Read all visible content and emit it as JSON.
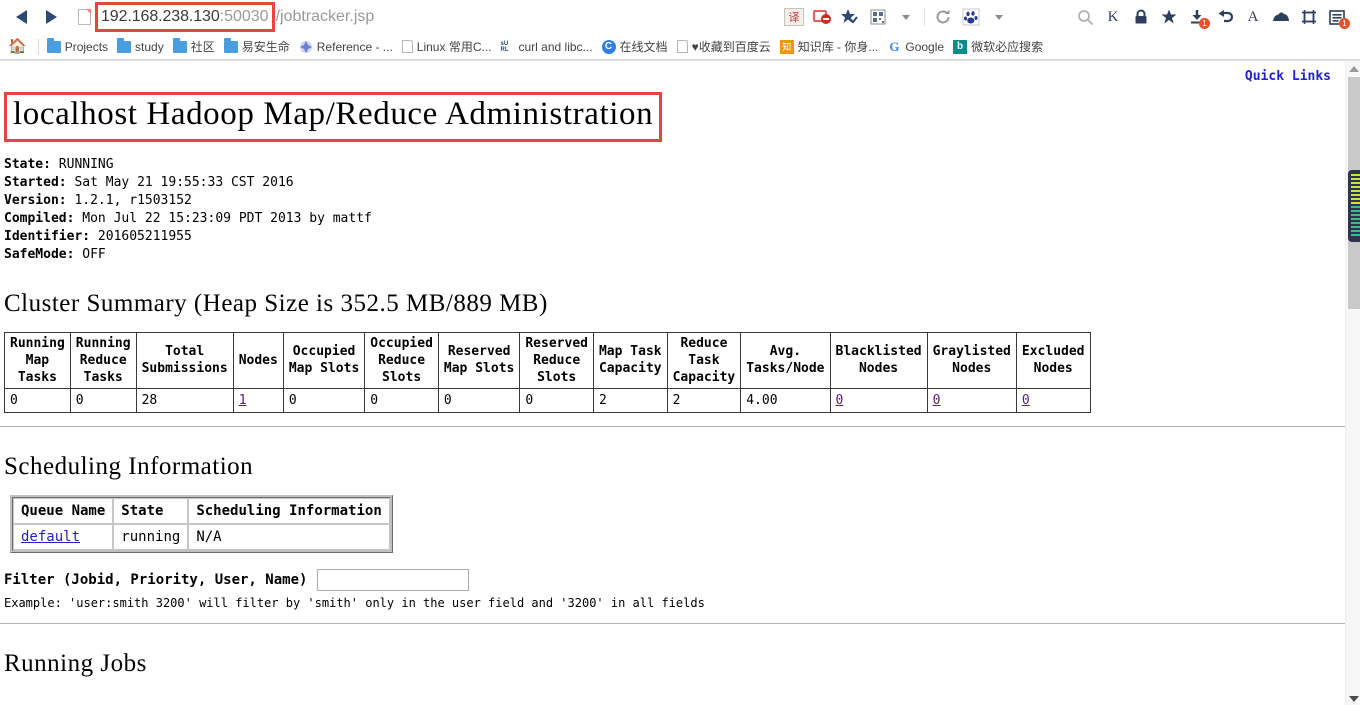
{
  "browser": {
    "nav": {
      "back_label": "Back",
      "forward_label": "Forward",
      "url_host": "192.168.238.130",
      "url_port": ":50030",
      "url_path": "/jobtracker.jsp"
    },
    "toolbar_right": [
      {
        "name": "translate-icon",
        "glyph": "译"
      },
      {
        "name": "block-ad-icon",
        "glyph": "⊘"
      },
      {
        "name": "favorite-check-icon",
        "glyph": "★"
      },
      {
        "name": "qrcode-icon",
        "glyph": "▦"
      },
      {
        "name": "chevron-down-icon",
        "glyph": "▾"
      },
      {
        "name": "reload-icon",
        "glyph": "⟳"
      },
      {
        "name": "baidu-paw-icon",
        "glyph": "🐾"
      },
      {
        "name": "chevron-down-icon-2",
        "glyph": "▾"
      },
      {
        "name": "search-icon",
        "glyph": "🔍"
      },
      {
        "name": "kingsoft-icon",
        "glyph": "K"
      },
      {
        "name": "lock-icon",
        "glyph": "🔒"
      },
      {
        "name": "star-icon",
        "glyph": "★"
      },
      {
        "name": "download-icon",
        "glyph": "⤓",
        "badge": "1"
      },
      {
        "name": "undo-icon",
        "glyph": "↩"
      },
      {
        "name": "font-icon",
        "glyph": "A"
      },
      {
        "name": "cloud-icon",
        "glyph": "☁"
      },
      {
        "name": "crop-icon",
        "glyph": "⛶"
      },
      {
        "name": "reader-icon",
        "glyph": "▤",
        "badge": "1"
      }
    ],
    "bookmarks": [
      {
        "name": "bookmark-home",
        "icon": "home-icon",
        "label": ""
      },
      {
        "name": "bookmark-projects",
        "icon": "folder-icon",
        "label": "Projects"
      },
      {
        "name": "bookmark-study",
        "icon": "folder-icon",
        "label": "study"
      },
      {
        "name": "bookmark-shequ",
        "icon": "folder-icon",
        "label": "社区"
      },
      {
        "name": "bookmark-yianshengming",
        "icon": "folder-icon",
        "label": "易安生命"
      },
      {
        "name": "bookmark-reference",
        "icon": "reference-icon",
        "label": "Reference - ..."
      },
      {
        "name": "bookmark-linux",
        "icon": "doc-icon",
        "label": "Linux 常用C..."
      },
      {
        "name": "bookmark-curl",
        "icon": "url-icon",
        "label": "curl and libc..."
      },
      {
        "name": "bookmark-zaixianwendang",
        "icon": "docs-icon",
        "label": "在线文档"
      },
      {
        "name": "bookmark-baiduyun",
        "icon": "doc-icon",
        "label": "♥收藏到百度云"
      },
      {
        "name": "bookmark-zhishiku",
        "icon": "zhishiku-icon",
        "label": "知识库 - 你身..."
      },
      {
        "name": "bookmark-google",
        "icon": "google-icon",
        "label": "Google"
      },
      {
        "name": "bookmark-bing",
        "icon": "bing-icon",
        "label": "微软必应搜索"
      }
    ]
  },
  "page": {
    "quick_links": "Quick Links",
    "title": "localhost Hadoop Map/Reduce Administration",
    "info": [
      {
        "key": "State:",
        "value": "RUNNING"
      },
      {
        "key": "Started:",
        "value": "Sat May 21 19:55:33 CST 2016"
      },
      {
        "key": "Version:",
        "value": "1.2.1, r1503152"
      },
      {
        "key": "Compiled:",
        "value": "Mon Jul 22 15:23:09 PDT 2013 by mattf"
      },
      {
        "key": "Identifier:",
        "value": "201605211955"
      },
      {
        "key": "SafeMode:",
        "value": "OFF"
      }
    ],
    "cluster_summary": {
      "heading": "Cluster Summary (Heap Size is 352.5 MB/889 MB)",
      "headers": [
        "Running\nMap\nTasks",
        "Running\nReduce\nTasks",
        "Total\nSubmissions",
        "Nodes",
        "Occupied\nMap Slots",
        "Occupied\nReduce\nSlots",
        "Reserved\nMap Slots",
        "Reserved\nReduce\nSlots",
        "Map Task\nCapacity",
        "Reduce\nTask\nCapacity",
        "Avg.\nTasks/Node",
        "Blacklisted\nNodes",
        "Graylisted\nNodes",
        "Excluded\nNodes"
      ],
      "values": [
        "0",
        "0",
        "28",
        "1",
        "0",
        "0",
        "0",
        "0",
        "2",
        "2",
        "4.00",
        "0",
        "0",
        "0"
      ],
      "link_columns": [
        3,
        11,
        12,
        13
      ]
    },
    "scheduling": {
      "heading": "Scheduling Information",
      "headers": [
        "Queue Name",
        "State",
        "Scheduling Information"
      ],
      "rows": [
        {
          "queue_name": "default",
          "state": "running",
          "info": "N/A"
        }
      ]
    },
    "filter": {
      "label": "Filter (Jobid, Priority, User, Name)",
      "value": "",
      "example": "Example: 'user:smith 3200' will filter by 'smith' only in the user field and '3200' in all fields"
    },
    "running_jobs_heading": "Running Jobs"
  },
  "colors": {
    "highlight_red": "#e8453c",
    "link_blue": "#2222cc",
    "visited_purple": "#551a8b"
  }
}
